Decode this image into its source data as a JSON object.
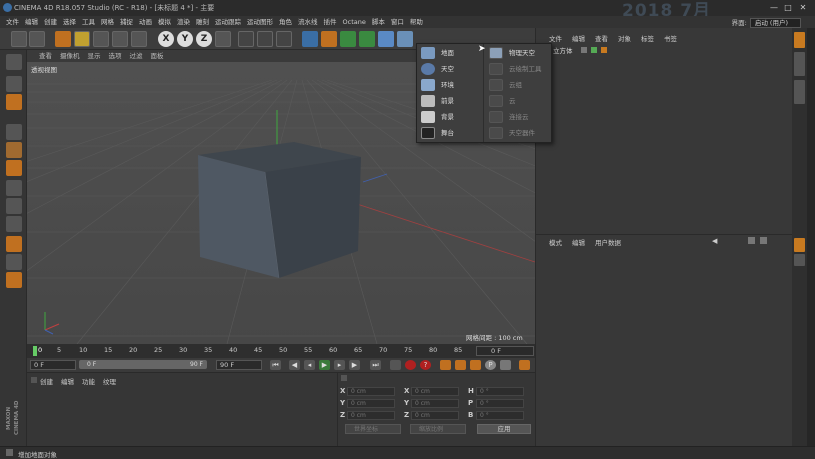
{
  "window": {
    "title": "CINEMA 4D R18.057 Studio (RC - R18) - [未标题 4 *] - 主要",
    "watermark": "2018 7月",
    "controls": [
      "—",
      "□",
      "✕"
    ]
  },
  "menubar": {
    "items": [
      "文件",
      "编辑",
      "创建",
      "选择",
      "工具",
      "网格",
      "捕捉",
      "动画",
      "模拟",
      "渲染",
      "雕刻",
      "运动跟踪",
      "运动图形",
      "角色",
      "流水线",
      "插件",
      "Octane",
      "脚本",
      "窗口",
      "帮助"
    ],
    "layout_label": "界面:",
    "layout_value": "启动 (用户)"
  },
  "toolbar": {
    "axis_buttons": [
      "X",
      "Y",
      "Z"
    ]
  },
  "viewport": {
    "menu": [
      "查看",
      "摄像机",
      "显示",
      "选项",
      "过滤",
      "面板"
    ],
    "label": "透视视图",
    "grid_info": "网格间距 : 100 cm"
  },
  "environment_menu": {
    "left_items": [
      {
        "label": "地面",
        "icon": "floor-icon"
      },
      {
        "label": "天空",
        "icon": "sky-icon"
      },
      {
        "label": "环境",
        "icon": "environment-icon"
      },
      {
        "label": "前景",
        "icon": "foreground-icon"
      },
      {
        "label": "背景",
        "icon": "background-icon"
      },
      {
        "label": "舞台",
        "icon": "stage-icon"
      }
    ],
    "right_items": [
      {
        "label": "物理天空",
        "icon": "physical-sky-icon",
        "enabled": true
      },
      {
        "label": "云绘制工具",
        "icon": "cloud-tool-icon",
        "enabled": false
      },
      {
        "label": "云组",
        "icon": "cloud-group-icon",
        "enabled": false
      },
      {
        "label": "云",
        "icon": "cloud-icon",
        "enabled": false
      },
      {
        "label": "连接云",
        "icon": "connect-cloud-icon",
        "enabled": false
      },
      {
        "label": "天空器件",
        "icon": "sky-tool-icon",
        "enabled": false
      }
    ]
  },
  "object_manager": {
    "menu": [
      "文件",
      "编辑",
      "查看",
      "对象",
      "标签",
      "书签"
    ],
    "objects": [
      {
        "name": "立方体"
      }
    ]
  },
  "attribute_manager": {
    "menu": [
      "模式",
      "编辑",
      "用户数据"
    ]
  },
  "timeline": {
    "ticks": [
      "0",
      "5",
      "10",
      "15",
      "20",
      "25",
      "30",
      "35",
      "40",
      "45",
      "50",
      "55",
      "60",
      "65",
      "70",
      "75",
      "80",
      "85",
      "90"
    ],
    "current_frame_right": "0 F"
  },
  "transport": {
    "start_field": "0 F",
    "range_start": "0 F",
    "range_end": "90 F",
    "end_field": "90 F"
  },
  "material_manager": {
    "menu": [
      "创建",
      "编辑",
      "功能",
      "纹理"
    ]
  },
  "coordinates": {
    "rows": [
      {
        "a": "X",
        "av": "0 cm",
        "b": "X",
        "bv": "0 cm",
        "c": "H",
        "cv": "0 °"
      },
      {
        "a": "Y",
        "av": "0 cm",
        "b": "Y",
        "bv": "0 cm",
        "c": "P",
        "cv": "0 °"
      },
      {
        "a": "Z",
        "av": "0 cm",
        "b": "Z",
        "bv": "0 cm",
        "c": "B",
        "cv": "0 °"
      }
    ],
    "mode1": "世界坐标",
    "mode2": "缩放比例",
    "apply": "应用"
  },
  "branding": "MAXON CINEMA 4D",
  "status": {
    "text": "增加地面对象"
  },
  "colors": {
    "accent_orange": "#c87a20",
    "viewport_bg": "#4e4e4e",
    "cube_front": "#4f5863",
    "cube_top": "#3f464d",
    "cube_side": "#3a4149"
  }
}
